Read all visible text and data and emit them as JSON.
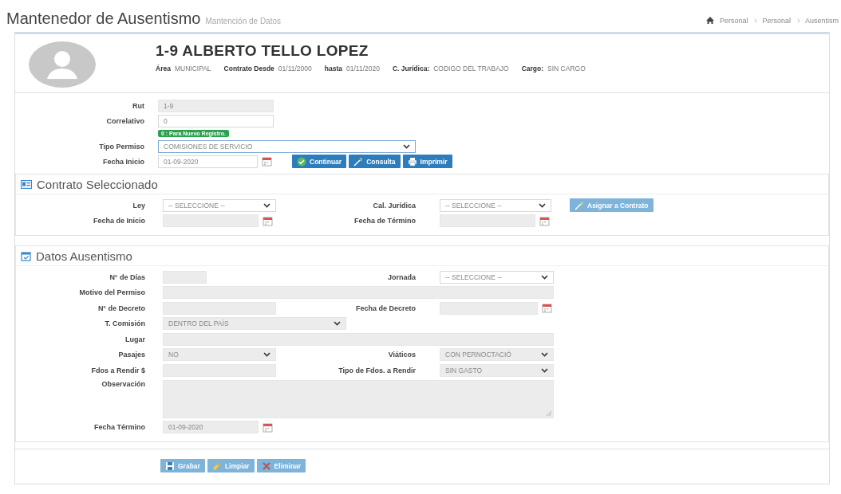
{
  "page": {
    "title": "Mantenedor de Ausentismo",
    "subtitle": "Mantención de Datos"
  },
  "breadcrumb": [
    {
      "label": "Personal"
    },
    {
      "label": "Personal"
    },
    {
      "label": "Ausentism"
    }
  ],
  "employee": {
    "name": "1-9  ALBERTO TELLO LOPEZ",
    "details": [
      {
        "label": "Área",
        "value": "MUNICIPAL"
      },
      {
        "label": "Contrato Desde",
        "value": "01/11/2000"
      },
      {
        "label": "hasta",
        "value": "01/11/2020"
      },
      {
        "label": "C. Jurídica:",
        "value": "CODIGO DEL TRABAJO"
      },
      {
        "label": "Cargo:",
        "value": "SIN CARGO"
      }
    ]
  },
  "general": {
    "rows": [
      [
        {
          "kind": "text",
          "label": "Rut",
          "value": "1-9",
          "disabled": true
        }
      ],
      [
        {
          "kind": "text",
          "label": "Correlativo",
          "value": "0",
          "disabled": false
        }
      ],
      [
        {
          "kind": "badge",
          "text": "0 : Para Nuevo Registro."
        }
      ],
      [
        {
          "kind": "select",
          "label": "Tipo Permiso",
          "value": "COMISIONES DE SERVICIO",
          "disabled": false
        }
      ],
      [
        {
          "kind": "date",
          "label": "Fecha Inicio",
          "value": "01-09-2020",
          "disabled": false
        },
        {
          "kind": "button",
          "label": "Continuar",
          "disabled": false
        },
        {
          "kind": "button",
          "label": "Consulta",
          "disabled": false
        },
        {
          "kind": "button",
          "label": "Imprimir",
          "disabled": false
        }
      ]
    ]
  },
  "sections": [
    {
      "title": "Contrato Seleccionado",
      "rows": [
        [
          {
            "kind": "select",
            "label": "Ley",
            "value": "-- SELECCIONE --",
            "disabled": false
          },
          {
            "kind": "select",
            "label": "Cal. Jurídica",
            "value": "-- SELECCIONE --",
            "disabled": false
          },
          {
            "kind": "button",
            "label": "Asignar a Contrato",
            "disabled": true
          }
        ],
        [
          {
            "kind": "date",
            "label": "Fecha de Inicio",
            "disabled": true
          },
          {
            "kind": "date",
            "label": "Fecha de Término",
            "disabled": true
          }
        ]
      ]
    },
    {
      "title": "Datos Ausentismo",
      "rows": [
        [
          {
            "kind": "text",
            "label": "N° de Días",
            "disabled": true
          },
          {
            "kind": "select",
            "label": "Jornada",
            "value": "-- SELECCIONE --",
            "disabled": false
          }
        ],
        [
          {
            "kind": "text",
            "label": "Motivo del Permiso",
            "disabled": true
          }
        ],
        [
          {
            "kind": "text",
            "label": "N° de Decreto",
            "disabled": true
          },
          {
            "kind": "date",
            "label": "Fecha de Decreto",
            "disabled": true
          }
        ],
        [
          {
            "kind": "select",
            "label": "T. Comisión",
            "value": "DENTRO DEL PAÍS",
            "disabled": true
          }
        ],
        [
          {
            "kind": "text",
            "label": "Lugar",
            "disabled": true
          }
        ],
        [
          {
            "kind": "select",
            "label": "Pasajes",
            "value": "NO",
            "disabled": true
          },
          {
            "kind": "select",
            "label": "Viáticos",
            "value": "CON PERNOCTACIÓ",
            "disabled": true
          }
        ],
        [
          {
            "kind": "text",
            "label": "Fdos a Rendir $",
            "disabled": true
          },
          {
            "kind": "select",
            "label": "Tipo de Fdos. a Rendir",
            "value": "SIN GASTO",
            "disabled": true
          }
        ],
        [
          {
            "kind": "textarea",
            "label": "Observación",
            "disabled": true
          }
        ],
        [
          {
            "kind": "date",
            "label": "Fecha Término",
            "value": "01-09-2020",
            "disabled": true
          }
        ]
      ]
    }
  ],
  "footer_buttons": [
    {
      "label": "Grabar",
      "disabled": true
    },
    {
      "label": "Limpiar",
      "disabled": true
    },
    {
      "label": "Eliminar",
      "disabled": true
    }
  ]
}
